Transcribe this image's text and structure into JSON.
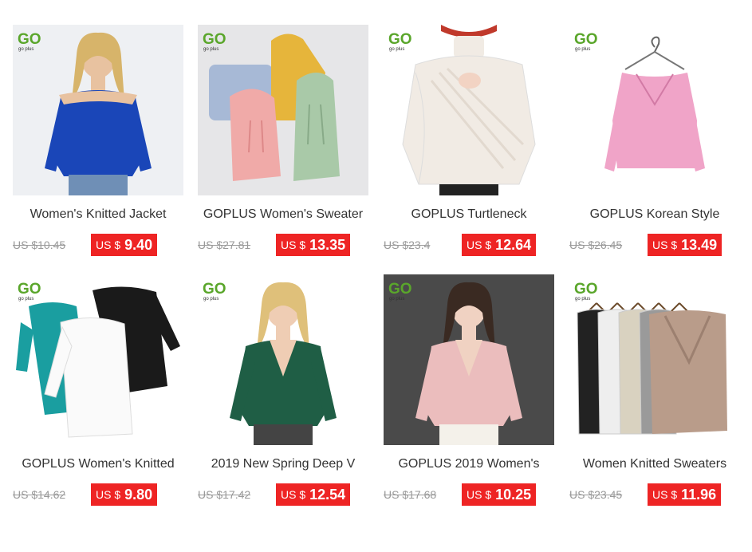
{
  "brand": {
    "logo_text": "GO",
    "logo_sub": "go plus"
  },
  "products": [
    {
      "title": "Women's Knitted Jacket",
      "old_price": "US $10.45",
      "currency": "US $",
      "price": "9.40",
      "bg": "#eef0f3",
      "garment": "#1a46b8",
      "skin": "#e8c2a0",
      "hair": "#d7b46a",
      "pants": "#6f8fb6",
      "kind": "model-offshoulder"
    },
    {
      "title": "GOPLUS Women's Sweater",
      "old_price": "US $27.81",
      "currency": "US $",
      "price": "13.35",
      "bg": "#e6e6e8",
      "kind": "hoodies",
      "colors": [
        "#a7b9d6",
        "#e6b53b",
        "#f0aaa8",
        "#a9c9a8"
      ]
    },
    {
      "title": "GOPLUS Turtleneck",
      "old_price": "US $23.4",
      "currency": "US $",
      "price": "12.64",
      "bg": "#ffffff",
      "garment": "#f1ebe4",
      "skin": "#f2d3c3",
      "kind": "model-turtleneck"
    },
    {
      "title": "GOPLUS Korean Style",
      "old_price": "US $26.45",
      "currency": "US $",
      "price": "13.49",
      "bg": "#ffffff",
      "garment": "#f0a4c8",
      "kind": "hanger-top"
    },
    {
      "title": "GOPLUS Women's Knitted",
      "old_price": "US $14.62",
      "currency": "US $",
      "price": "9.80",
      "bg": "#ffffff",
      "kind": "three-dresses",
      "colors": [
        "#1a9ea0",
        "#1a1a1a",
        "#fafafa"
      ]
    },
    {
      "title": "2019 New Spring Deep V",
      "old_price": "US $17.42",
      "currency": "US $",
      "price": "12.54",
      "bg": "#ffffff",
      "garment": "#1f5e45",
      "skin": "#efcdb4",
      "hair": "#dfc07a",
      "pants": "#444444",
      "kind": "model-deepv"
    },
    {
      "title": "GOPLUS 2019 Women's",
      "old_price": "US $17.68",
      "currency": "US $",
      "price": "10.25",
      "bg": "#4a4a4a",
      "garment": "#ebbdbd",
      "skin": "#f0d2c2",
      "hair": "#3a2a22",
      "pants": "#f4f1ea",
      "kind": "model-pink"
    },
    {
      "title": "Women Knitted Sweaters",
      "old_price": "US $23.45",
      "currency": "US $",
      "price": "11.96",
      "bg": "#ffffff",
      "kind": "vests",
      "colors": [
        "#222222",
        "#eeeeee",
        "#d9d2c0",
        "#9a9a9a",
        "#b99c8a"
      ]
    }
  ]
}
